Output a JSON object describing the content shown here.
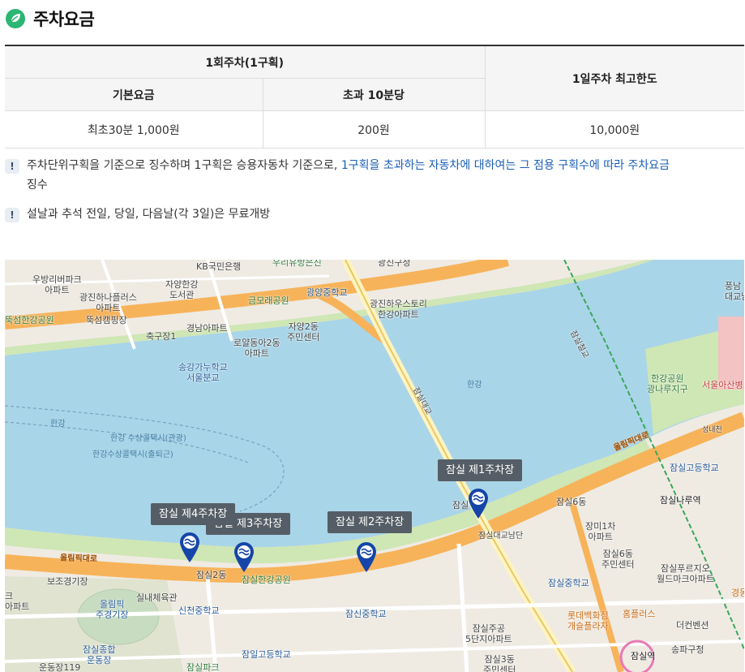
{
  "header": {
    "title": "주차요금"
  },
  "fee_table": {
    "group_header": "1회주차(1구획)",
    "col_base": "기본요금",
    "col_extra": "초과 10분당",
    "col_daily": "1일주차 최고한도",
    "row": {
      "base": "최초30분 1,000원",
      "extra": "200원",
      "daily": "10,000원"
    }
  },
  "notes": [
    {
      "icon": "!",
      "text": "주차단위구획을 기준으로 징수하며 1구획은 승용자동차 기준으로, ",
      "highlight": "1구획을 초과하는 자동차에 대하여는 그 점용 구획수에 따라 주차요금",
      "tail": "징수"
    },
    {
      "icon": "!",
      "text": "설날과 추석 전일, 당일, 다음날(각 3일)은 무료개방"
    }
  ],
  "map": {
    "parking": [
      {
        "name": "잠실 제1주차장"
      },
      {
        "name": "잠실 제2주차장"
      },
      {
        "name": "잠실 제3주차장"
      },
      {
        "name": "잠실 제4주차장"
      }
    ],
    "labels": {
      "kb": "KB국민은행",
      "banpo": "우리유방은진",
      "gwangjin_top": "광진구청",
      "woobang": "우방리버파크\n아파트",
      "gwangjin_hana": "광진하나플러스\n아파트",
      "jayang_lib": "자양한강\n도서관",
      "gwangyang": "광양중학교",
      "geumorae": "금모래공원",
      "gwangjin_uous": "광진하우스토리\n한강아파트",
      "ttukseom_park": "뚝섬한강공원",
      "ttukseom_camp": "뚝섬캠핑장",
      "chukgu": "축구장1",
      "gyeongnam": "경남아파트",
      "roal": "로얄동아2동\n아파트",
      "jayang2": "자양2동\n주민센터",
      "songgang": "송강가누학교\n서울분교",
      "hangang_water": "한강",
      "hangang_water2": "한강",
      "ferry1": "한강 수상콜택시(관광)",
      "ferry2": "한강수상콜택시(출퇴근)",
      "jamsil_bridge": "잠실대교",
      "jamsil_cheolgyo": "잠실철교",
      "hangang_park_e": "한강공원\n광나루지구",
      "asan": "서울아산병",
      "seongnae": "성내천",
      "jamsil_hs_top": "잠실고등학교",
      "jamsilnaru": "잠실나루역",
      "jamsil6": "잠실6동",
      "jangmi": "장미1차\n아파트",
      "jamsil6_center": "잠실6동\n주민센터",
      "jamsil_middle": "잠실중학교",
      "palace": "잠실푸르지오\n월드마크아파트",
      "lotte": "롯데백화점\n개슬플라자",
      "homeplus": "홈플러스",
      "thecon": "더컨벤션",
      "songpa": "송파구청",
      "jamsil_st": "잠실역",
      "jamsil2": "잠실2동",
      "jamsil_hg_park": "잠실한강공원",
      "jamsil_ic_south": "잠실대교남단",
      "jamsil_fee_small": "잠실",
      "olympic_road": "올림픽대로",
      "olympic_road2": "올림픽대로",
      "bojo": "보조경기장",
      "olympic_main": "올림픽\n주경기장",
      "sports_complex": "잠실종합\n운동장",
      "undong119": "운동장119",
      "gym": "실내체육관",
      "sincheon": "신천중학교",
      "jamsin": "잠신중학교",
      "jamsil_hs2": "잠일고등학교",
      "jamsil_jugong": "잠실주공\n5단지아파트",
      "jamsil3": "잠실3동\n주민센터",
      "jamsil_park2": "잠실파크",
      "apt_left": "크\n아파트",
      "pungnap": "풍남\n대교남",
      "gyeong": "경동"
    }
  },
  "colors": {
    "accent_link": "#1a5fb4",
    "river": "#a9d5e8",
    "park": "#cfe6b5",
    "road": "#f7b35a",
    "tag": "#555e66",
    "pin": "#1545a8"
  }
}
